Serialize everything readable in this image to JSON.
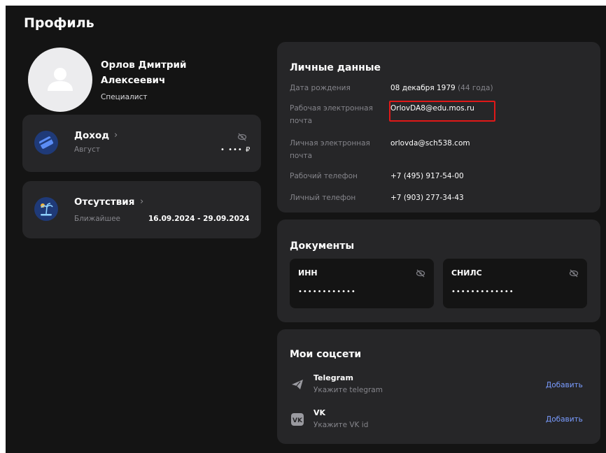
{
  "page": {
    "title": "Профиль"
  },
  "profile": {
    "name": "Орлов Дмитрий Алексеевич",
    "role": "Специалист"
  },
  "income_card": {
    "title": "Доход",
    "period": "Август",
    "amount_masked": "• ••• ₽",
    "icons": [
      "card-icon",
      "hidden-eye-icon",
      "chevron-right-icon"
    ]
  },
  "absence_card": {
    "title": "Отсутствия",
    "label": "Ближайшее",
    "range": "16.09.2024 - 29.09.2024",
    "icons": [
      "vacation-palm-icon",
      "chevron-right-icon"
    ]
  },
  "personal": {
    "title": "Личные данные",
    "rows": [
      {
        "label": "Дата рождения",
        "value": "08 декабря 1979",
        "extra": "(44 года)"
      },
      {
        "label": "Рабочая электронная почта",
        "value": "OrlovDA8@edu.mos.ru"
      },
      {
        "label": "Личная электронная почта",
        "value": "orlovda@sch538.com"
      },
      {
        "label": "Рабочий телефон",
        "value": "+7 (495) 917-54-00"
      },
      {
        "label": "Личный телефон",
        "value": "+7 (903) 277-34-43"
      }
    ],
    "highlight_color": "#e01818"
  },
  "documents": {
    "title": "Документы",
    "items": [
      {
        "label": "ИНН",
        "value_masked": "••••••••••••"
      },
      {
        "label": "СНИЛС",
        "value_masked": "•••••••••••••"
      }
    ]
  },
  "social": {
    "title": "Мои соцсети",
    "items": [
      {
        "name": "Telegram",
        "hint": "Укажите telegram",
        "action": "Добавить",
        "icon": "telegram-icon"
      },
      {
        "name": "VK",
        "hint": "Укажите VK id",
        "action": "Добавить",
        "icon": "vk-icon"
      }
    ]
  },
  "colors": {
    "background": "#141414",
    "card": "#262628",
    "accent_link": "#7a9cff",
    "icon_circle": "#1f3a78",
    "muted_text": "#85858b"
  }
}
